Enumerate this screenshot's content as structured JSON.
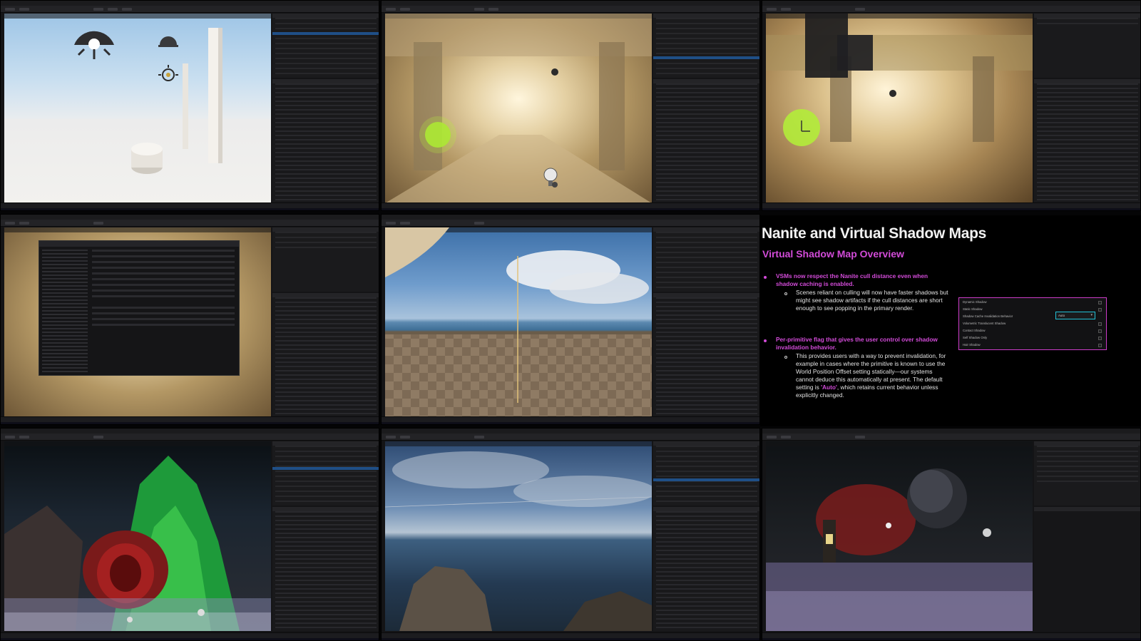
{
  "slide": {
    "title": "Nanite and Virtual Shadow Maps",
    "subtitle": "Virtual Shadow Map Overview",
    "bullets": [
      {
        "main": "VSMs now respect the Nanite cull distance even when shadow caching is enabled.",
        "sub": "Scenes reliant on culling will now have faster shadows but might see shadow artifacts if the cull distances are short enough to see popping in the primary render."
      },
      {
        "main": "Per-primitive flag that gives the user control over shadow invalidation behavior.",
        "sub_before": "This provides users with a way to prevent invalidation, for example in cases where the primitive is known to use the World Position Offset setting statically—our systems cannot deduce this automatically at present. The default setting is ",
        "sub_highlight": "'Auto'",
        "sub_after": ", which retains current behavior unless explicitly changed."
      }
    ],
    "settings_panel": {
      "rows": [
        "Dynamic Shadow",
        "Static Shadow",
        "Shadow Cache Invalidation Behavior",
        "Volumetric Translucent Shadow",
        "Contact Shadow",
        "Self Shadow Only",
        "Hair Shadow"
      ],
      "dropdown_value": "Auto"
    }
  },
  "colors": {
    "accent": "#d24bd8",
    "highlight_border": "#cc3cc8",
    "dropdown_border": "#22c1d6",
    "selection": "#1f4f87"
  },
  "icons": [
    "directional-light-icon",
    "sky-light-icon",
    "point-light-icon"
  ]
}
